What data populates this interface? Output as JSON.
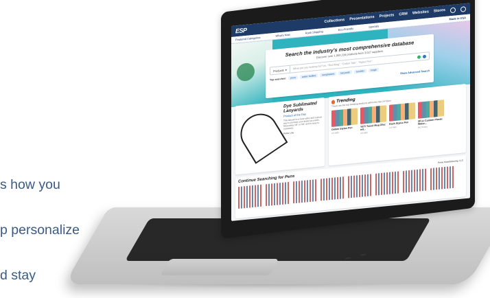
{
  "left_copy": {
    "lines": [
      "s how you",
      "p personalize",
      "d stay"
    ]
  },
  "ui": {
    "logo": "ESP",
    "top_nav": [
      "Collections",
      "Presentations",
      "Projects",
      "CRM",
      "Websites",
      "Stores"
    ],
    "subbar": {
      "left": "Featured Categories",
      "items": [
        "What's New",
        "Rush Shipping",
        "Eco-Friendly"
      ],
      "right": "Made in USA",
      "specials": "Specials"
    },
    "search": {
      "title": "Search the industry's most comprehensive database",
      "subtitle": "Discover over 1,000,316 products from 3,027 suppliers",
      "category": "Products",
      "placeholder": "What are you looking for? ex. \"Red Mug\", \"Cotton Tote\", \"Stylus Pen\"",
      "top_searches_label": "Top searches:",
      "top_searches": [
        "pens",
        "water bottles",
        "sunglasses",
        "lanyards",
        "tumbler",
        "mugs"
      ],
      "advanced_link": "Show Advanced Search"
    },
    "feature": {
      "title": "Dye Sublimated Lanyards",
      "subtitle": "Product of the Day",
      "description": "This lanyard is a best-seller and a great way to promote your brand at events. Measuring 7/8\" or 3/4\" and is easy to customize.",
      "supplier": "Prime Line"
    },
    "trending": {
      "title": "Trending",
      "description": "These are the top trending products within the last 24 hours",
      "products": [
        {
          "name": "Online Stylus Pen",
          "meta": "4.5 stars"
        },
        {
          "name": "YETI Travel Mug 20oz wit...",
          "meta": "4.6 stars"
        },
        {
          "name": "Dash Stylus Pen",
          "meta": "4.4 stars"
        },
        {
          "name": "28 oz Custom Plastic Water...",
          "meta": "BIC Promo"
        }
      ]
    },
    "continue": {
      "title": "Continue Searching for Pens",
      "supplier": "Prime Manufacturing, LLC"
    }
  },
  "colors": {
    "topbar": "#1d3b66",
    "accent": "#1f62a7",
    "hero": "#2fb3bf",
    "left_copy": "#3a5a86"
  },
  "icons": {
    "help": "help-icon",
    "user": "user-icon",
    "search": "search-icon",
    "flame": "flame-icon"
  }
}
